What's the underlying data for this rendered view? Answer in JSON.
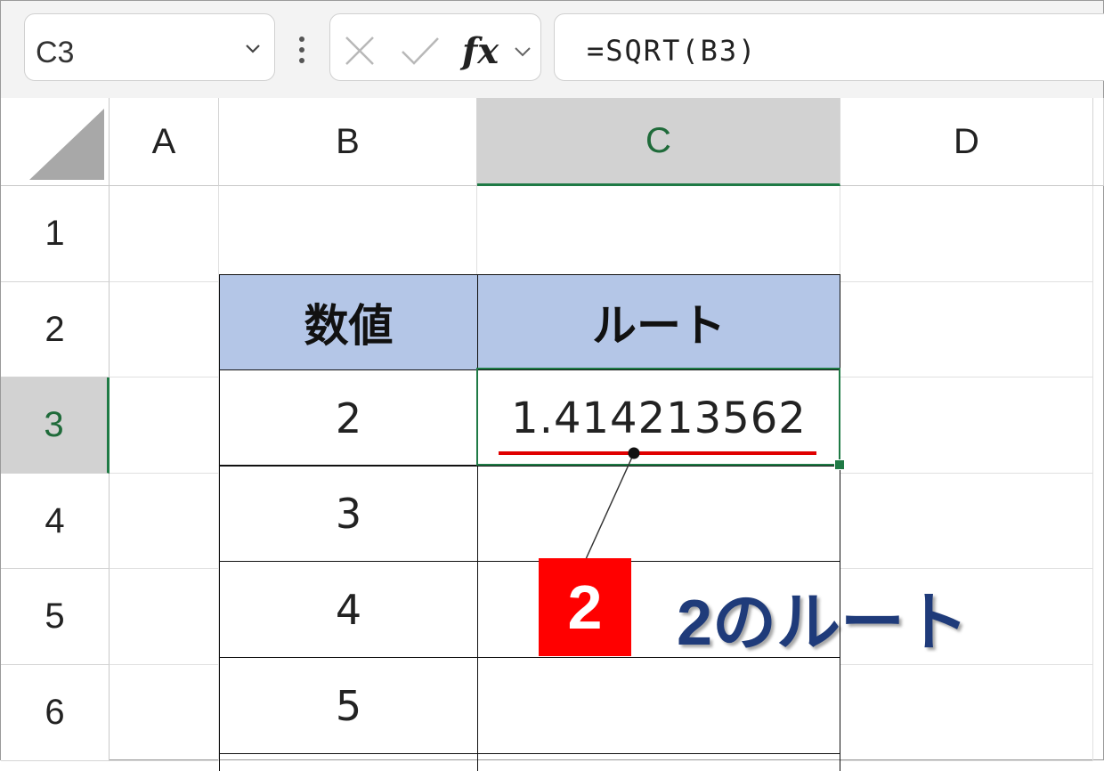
{
  "formula_bar": {
    "name_box": "C3",
    "fx_label": "fx",
    "formula": "=SQRT(B3)"
  },
  "columns": [
    "A",
    "B",
    "C",
    "D"
  ],
  "selected_column": "C",
  "rows": [
    "1",
    "2",
    "3",
    "4",
    "5",
    "6"
  ],
  "selected_row": "3",
  "table": {
    "header_number": "数値",
    "header_root": "ルート",
    "numbers": [
      "2",
      "3",
      "4",
      "5"
    ],
    "root_results": [
      "1.414213562",
      "",
      "",
      ""
    ]
  },
  "annotation": {
    "badge": "2",
    "text": "2のルート"
  },
  "colors": {
    "header_fill": "#b4c6e7",
    "selection": "#1f7a45",
    "badge": "#ff0000",
    "underline": "#e00000",
    "callout_text": "#1f3b7a"
  }
}
